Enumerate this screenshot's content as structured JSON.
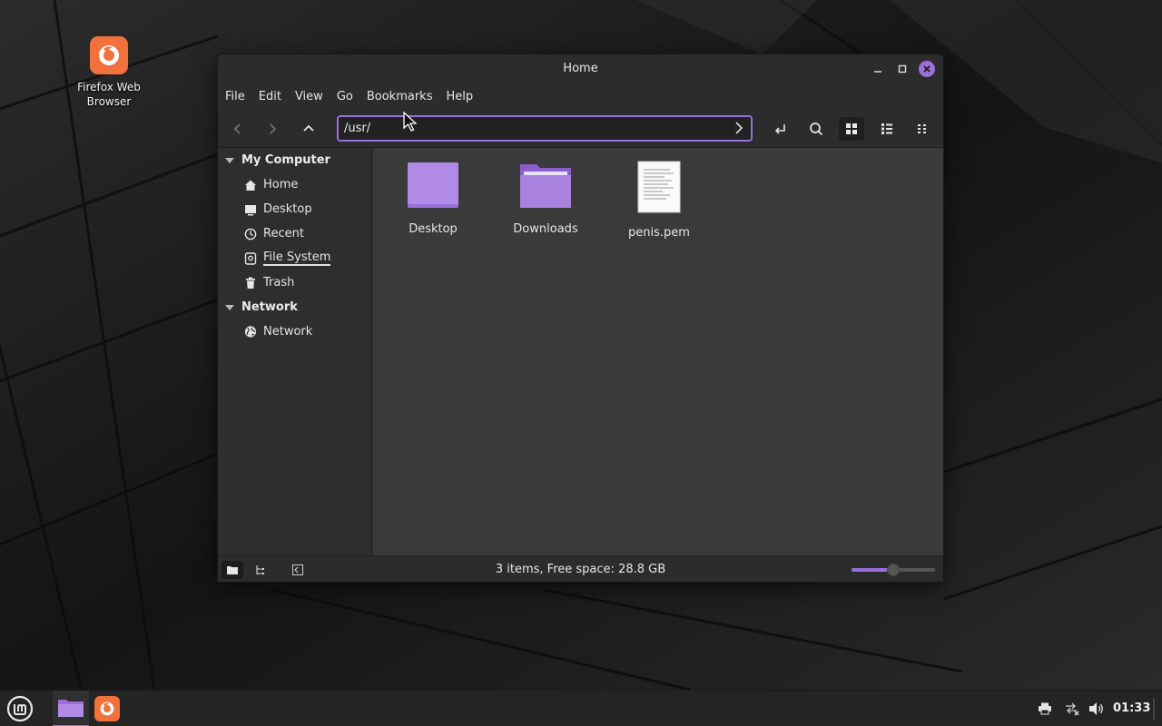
{
  "desktop": {
    "icons": [
      {
        "label_line1": "Firefox Web",
        "label_line2": "Browser",
        "icon": "firefox-icon"
      }
    ]
  },
  "window": {
    "title": "Home",
    "controls": {
      "minimize": "–",
      "maximize": "□",
      "close": "×"
    },
    "menu": [
      "File",
      "Edit",
      "View",
      "Go",
      "Bookmarks",
      "Help"
    ],
    "toolbar": {
      "location_value": "/usr/",
      "buttons": [
        "back-icon",
        "forward-icon",
        "up-icon",
        "toggle-location-icon",
        "search-icon",
        "icon-view-icon",
        "list-view-icon",
        "compact-view-icon"
      ]
    },
    "sidebar": {
      "sections": [
        {
          "title": "My Computer",
          "items": [
            "Home",
            "Desktop",
            "Recent",
            "File System",
            "Trash"
          ]
        },
        {
          "title": "Network",
          "items": [
            "Network"
          ]
        }
      ]
    },
    "files": [
      {
        "name": "Desktop",
        "type": "folder"
      },
      {
        "name": "Downloads",
        "type": "folder"
      },
      {
        "name": "penis.pem",
        "type": "text-file"
      }
    ],
    "status": {
      "text": "3 items, Free space: 28.8 GB",
      "zoom_level": 0.5
    }
  },
  "taskbar": {
    "clock": "01:33"
  },
  "colors": {
    "accent": "#9b6fd9",
    "firefox": "#f0713b"
  }
}
